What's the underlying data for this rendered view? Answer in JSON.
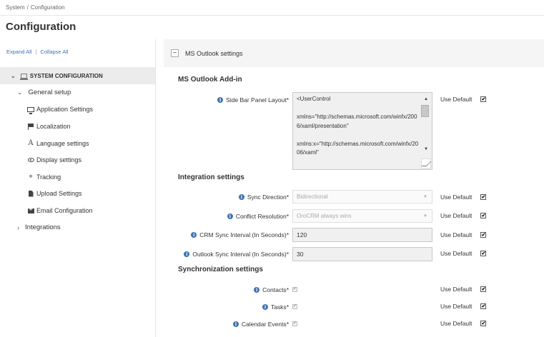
{
  "breadcrumb": {
    "root": "System",
    "separator": "/",
    "current": "Configuration"
  },
  "page_title": "Configuration",
  "sidebar": {
    "expand_all": "Expand All",
    "divider": "|",
    "collapse_all": "Collapse All",
    "root": {
      "label": "SYSTEM CONFIGURATION",
      "icon": "system-icon"
    },
    "general_setup": {
      "label": "General setup"
    },
    "items": [
      {
        "label": "Application Settings",
        "icon": "monitor-icon"
      },
      {
        "label": "Localization",
        "icon": "flag-icon"
      },
      {
        "label": "Language settings",
        "icon": "font-icon"
      },
      {
        "label": "Display settings",
        "icon": "eye-icon"
      },
      {
        "label": "Tracking",
        "icon": "crosshair-icon"
      },
      {
        "label": "Upload Settings",
        "icon": "document-icon"
      },
      {
        "label": "Email Configuration",
        "icon": "envelope-icon"
      }
    ],
    "integrations": {
      "label": "Integrations"
    }
  },
  "section": {
    "collapse_symbol": "−",
    "title": "MS Outlook settings"
  },
  "addin": {
    "heading": "MS Outlook Add-in",
    "side_bar_label": "Side Bar Panel Layout",
    "side_bar_value": "<UserControl\n\nxmlns=\"http://schemas.microsoft.com/winfx/2006/xaml/presentation\"\n\nxmlns:x=\"http://schemas.microsoft.com/winfx/2006/xaml\""
  },
  "integration": {
    "heading": "Integration settings",
    "sync_direction_label": "Sync Direction",
    "sync_direction_value": "Bidirectional",
    "conflict_label": "Conflict Resolution",
    "conflict_value": "OroCRM always wins",
    "crm_interval_label": "CRM Sync Interval (In Seconds)",
    "crm_interval_value": "120",
    "outlook_interval_label": "Outlook Sync Interval (In Seconds)",
    "outlook_interval_value": "30"
  },
  "synchronization": {
    "heading": "Synchronization settings",
    "contacts_label": "Contacts",
    "tasks_label": "Tasks",
    "calendar_label": "Calendar Events"
  },
  "common": {
    "required_mark": "*",
    "use_default": "Use Default",
    "check_mark": "✔",
    "info_glyph": "i"
  },
  "colors": {
    "accent": "#3e71b4",
    "sidebar_selected_bg": "#ececec",
    "section_header_bg": "#f5f5f5"
  }
}
